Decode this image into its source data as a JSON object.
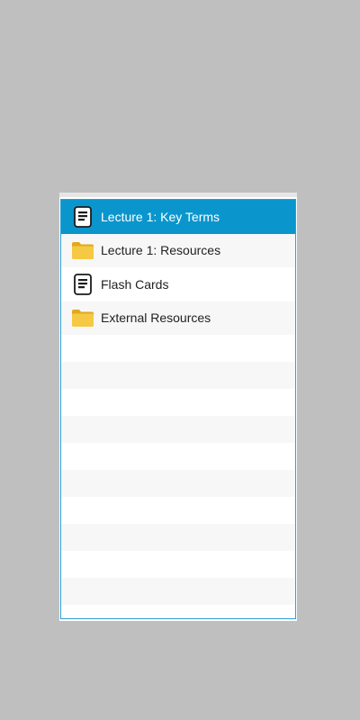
{
  "items": [
    {
      "label": "Lecture 1: Key Terms",
      "icon": "document-icon",
      "selected": true
    },
    {
      "label": "Lecture 1: Resources",
      "icon": "folder-icon",
      "selected": false
    },
    {
      "label": "Flash Cards",
      "icon": "document-icon",
      "selected": false
    },
    {
      "label": "External Resources",
      "icon": "folder-icon",
      "selected": false
    }
  ],
  "colors": {
    "selection": "#0a96cd",
    "list_border": "#2b9fd6",
    "folder": "#f2c438",
    "background": "#bfbfbf"
  }
}
